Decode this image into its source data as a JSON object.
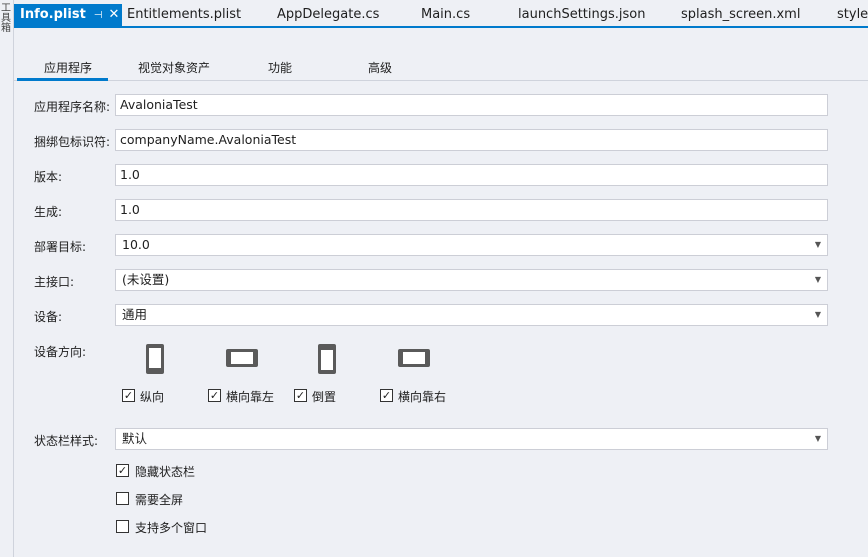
{
  "side_strip": {
    "text": "工具箱"
  },
  "doc_tabs": [
    {
      "label": "Info.plist",
      "active": true
    },
    {
      "label": "Entitlements.plist"
    },
    {
      "label": "AppDelegate.cs"
    },
    {
      "label": "Main.cs"
    },
    {
      "label": "launchSettings.json"
    },
    {
      "label": "splash_screen.xml"
    },
    {
      "label": "styles"
    }
  ],
  "doc_tab_pin_glyph": "⊣",
  "doc_tab_close_glyph": "✕",
  "sub_tabs": [
    {
      "label": "应用程序",
      "active": true
    },
    {
      "label": "视觉对象资产"
    },
    {
      "label": "功能"
    },
    {
      "label": "高级"
    }
  ],
  "form": {
    "app_name": {
      "label": "应用程序名称:",
      "value": "AvaloniaTest"
    },
    "bundle_id": {
      "label": "捆绑包标识符:",
      "value": "companyName.AvaloniaTest"
    },
    "version": {
      "label": "版本:",
      "value": "1.0"
    },
    "build": {
      "label": "生成:",
      "value": "1.0"
    },
    "deployment_target": {
      "label": "部署目标:",
      "value": "10.0"
    },
    "main_interface": {
      "label": "主接口:",
      "value": "(未设置)"
    },
    "devices": {
      "label": "设备:",
      "value": "通用"
    },
    "orientation": {
      "label": "设备方向:",
      "options": [
        {
          "label": "纵向",
          "checked": true,
          "icon": "phone-portrait-icon"
        },
        {
          "label": "横向靠左",
          "checked": true,
          "icon": "phone-landscape-left-icon"
        },
        {
          "label": "倒置",
          "checked": true,
          "icon": "phone-upside-down-icon"
        },
        {
          "label": "横向靠右",
          "checked": true,
          "icon": "phone-landscape-right-icon"
        }
      ]
    },
    "status_bar_style": {
      "label": "状态栏样式:",
      "value": "默认"
    },
    "options": [
      {
        "label": "隐藏状态栏",
        "checked": true
      },
      {
        "label": "需要全屏",
        "checked": false
      },
      {
        "label": "支持多个窗口",
        "checked": false
      }
    ]
  },
  "dropdown_arrow_glyph": "▼",
  "check_glyph": "✓",
  "colors": {
    "accent": "#007acc",
    "background": "#eef0f5",
    "icon": "#5a5a5a"
  }
}
